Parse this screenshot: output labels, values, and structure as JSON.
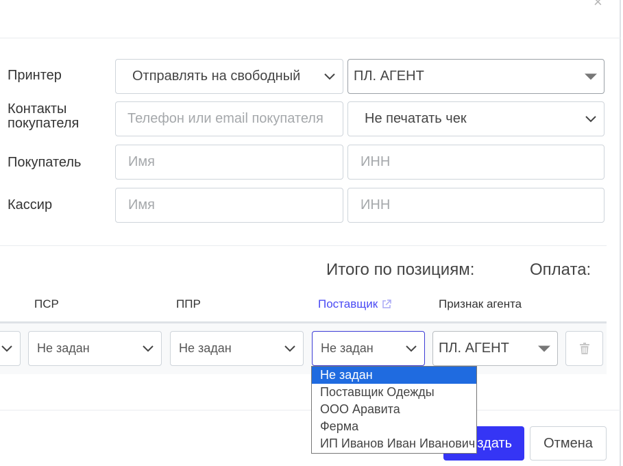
{
  "close_symbol": "×",
  "form": {
    "printer": {
      "label": "Принтер",
      "select_value": "Отправлять на свободный",
      "agent_value": "ПЛ. АГЕНТ"
    },
    "contacts": {
      "label": "Контакты\nпокупателя",
      "placeholder": "Телефон или email покупателя",
      "receipt_option": "Не печатать чек"
    },
    "buyer": {
      "label": "Покупатель",
      "name_placeholder": "Имя",
      "inn_placeholder": "ИНН"
    },
    "cashier": {
      "label": "Кассир",
      "name_placeholder": "Имя",
      "inn_placeholder": "ИНН"
    }
  },
  "summary": {
    "total_label": "Итого по позициям:",
    "payment_label": "Оплата:"
  },
  "table": {
    "headers": {
      "psr": "ПСР",
      "ppr": "ППР",
      "supplier": "Поставщик",
      "agent_sign": "Признак агента"
    },
    "row": {
      "psr_value": "Не задан",
      "ppr_value": "Не задан",
      "supplier_value": "Не задан",
      "agent_value": "ПЛ. АГЕНТ"
    }
  },
  "supplier_dropdown": {
    "options": [
      "Не задан",
      "Поставщик Одежды",
      "ООО Аравита",
      "Ферма",
      "ИП Иванов Иван Иванович"
    ],
    "selected_index": 0
  },
  "footer": {
    "create_label": "оздать",
    "cancel_label": "Отмена"
  },
  "colors": {
    "primary": "#3535f5",
    "link": "#4a4af4",
    "option_active": "#1f6be0"
  }
}
